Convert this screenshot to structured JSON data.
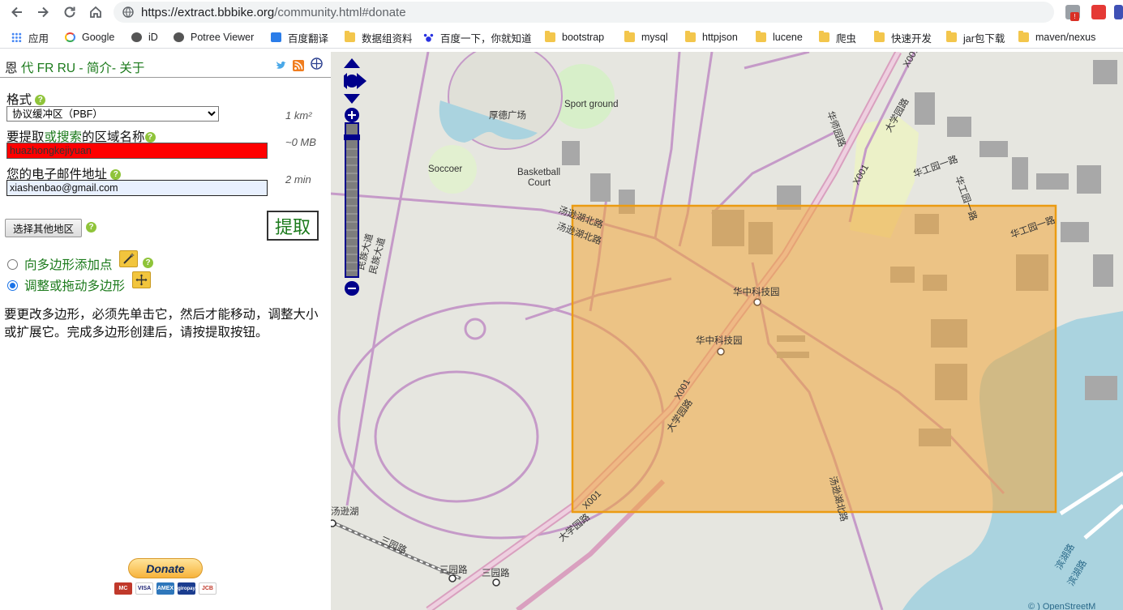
{
  "browser": {
    "url_host": "https://extract.bbbike.org",
    "url_rest": "/community.html#donate",
    "bookmarks": [
      {
        "label": "应用",
        "icon": "apps-grid-icon"
      },
      {
        "label": "Google",
        "icon": "google-icon"
      },
      {
        "label": "iD",
        "icon": "globe-icon"
      },
      {
        "label": "Potree Viewer",
        "icon": "globe-icon"
      },
      {
        "label": "百度翻译",
        "icon": "translate-icon"
      },
      {
        "label": "数据组资料",
        "icon": "folder-icon"
      },
      {
        "label": "百度一下，你就知道",
        "icon": "baidu-paw-icon"
      },
      {
        "label": "bootstrap",
        "icon": "folder-icon"
      },
      {
        "label": "mysql",
        "icon": "folder-icon"
      },
      {
        "label": "httpjson",
        "icon": "folder-icon"
      },
      {
        "label": "lucene",
        "icon": "folder-icon"
      },
      {
        "label": "爬虫",
        "icon": "folder-icon"
      },
      {
        "label": "快速开发",
        "icon": "folder-icon"
      },
      {
        "label": "jar包下载",
        "icon": "folder-icon"
      },
      {
        "label": "maven/nexus",
        "icon": "folder-icon"
      }
    ]
  },
  "panel": {
    "langs": {
      "current": "恩",
      "l1": "代",
      "l2": "FR",
      "l3": "RU",
      "sep": "-",
      "about": "简介",
      "sep2": "-",
      "about2": "关于"
    },
    "format_label": "格式",
    "format_value": "协议缓冲区（PBF）",
    "area_info": "1 km²",
    "name_label_a": "要提取",
    "name_label_b": "或搜索",
    "name_label_c": "的区域名称",
    "name_value": "huazhongkejiyuan",
    "size_info": "~0 MB",
    "email_label": "您的电子邮件地址",
    "email_value": "xiashenbao@gmail.com",
    "time_info": "2 min",
    "select_region_button": "选择其他地区",
    "extract_button": "提取",
    "radio_add_points": "向多边形添加点",
    "radio_adjust": "调整或拖动多边形",
    "instructions": "要更改多边形，必须先单击它，然后才能移动，调整大小或扩展它。完成多边形创建后，请按提取按钮。",
    "donate_label": "Donate",
    "cards": [
      "MC",
      "VISA",
      "AMEX",
      "giropay",
      "JCB"
    ]
  },
  "map": {
    "labels": {
      "houde": "厚德广场",
      "sport": "Sport ground",
      "soccer": "Soccoer",
      "basketball1": "Basketball",
      "basketball2": "Court",
      "tangxun_n1": "汤逊湖北路",
      "tangxun_n2": "汤逊湖北路",
      "hkj1": "华中科技园",
      "hkj2": "华中科技园",
      "daxueyuan_a": "大学园路",
      "daxueyuan_b": "大学园路",
      "daxueyuan_c": "大学园路",
      "x001_a": "X001",
      "x001_b": "X001",
      "x001_c": "X001",
      "x001_d": "X001",
      "minzu_a": "民族大道",
      "minzu_b": "民族大道",
      "huashi": "华师园路",
      "huagong1": "华工园一路",
      "huagong2": "华工园一路",
      "huagongyuan": "华工园一路",
      "tangxun_lake": "汤逊湖",
      "tangxun_s": "汤逊湖北路",
      "sanyuan1": "三园路",
      "sanyuan2": "三园路",
      "sanyuan3": "三园路",
      "binhu_a": "滨湖路",
      "binhu_b": "滨湖路",
      "attribution": "© ) OpenStreetM"
    }
  }
}
